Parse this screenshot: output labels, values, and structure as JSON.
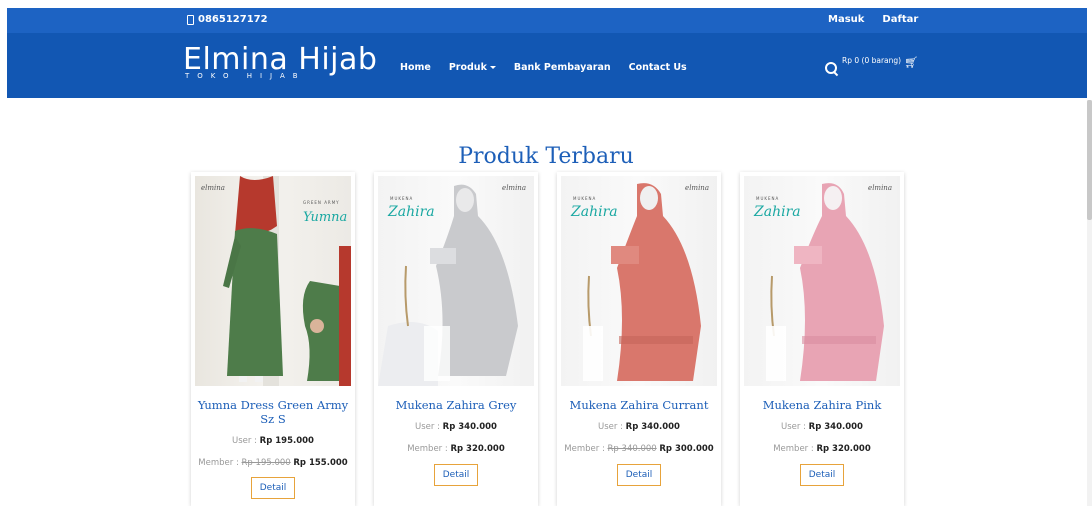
{
  "topbar": {
    "phone": "0865127172",
    "login": "Masuk",
    "register": "Daftar"
  },
  "brand": {
    "name": "Elmina Hijab",
    "tagline": "TOKO HIJAB"
  },
  "nav": {
    "home": "Home",
    "products": "Produk",
    "bank": "Bank Pembayaran",
    "contact": "Contact Us"
  },
  "cart": {
    "summary": "Rp 0 (0 barang)"
  },
  "section": {
    "title": "Produk Terbaru"
  },
  "products": [
    {
      "name": "Yumna Dress Green Army Sz S",
      "user_label": "User :",
      "user_price": "Rp 195.000",
      "member_label": "Member :",
      "member_old": "Rp 195.000",
      "member_price": "Rp 155.000",
      "detail": "Detail",
      "image_title": "Yumna",
      "image_subtitle": "GREEN ARMY",
      "image_brand": "elmina"
    },
    {
      "name": "Mukena Zahira Grey",
      "user_label": "User :",
      "user_price": "Rp 340.000",
      "member_label": "Member :",
      "member_old": "",
      "member_price": "Rp 320.000",
      "detail": "Detail",
      "image_title": "Zahira",
      "image_subtitle": "MUKENA",
      "image_brand": "elmina"
    },
    {
      "name": "Mukena Zahira Currant",
      "user_label": "User :",
      "user_price": "Rp 340.000",
      "member_label": "Member :",
      "member_old": "Rp 340.000",
      "member_price": "Rp 300.000",
      "detail": "Detail",
      "image_title": "Zahira",
      "image_subtitle": "MUKENA",
      "image_brand": "elmina"
    },
    {
      "name": "Mukena Zahira Pink",
      "user_label": "User :",
      "user_price": "Rp 340.000",
      "member_label": "Member :",
      "member_old": "",
      "member_price": "Rp 320.000",
      "detail": "Detail",
      "image_title": "Zahira",
      "image_subtitle": "MUKENA",
      "image_brand": "elmina"
    }
  ],
  "icons": {
    "phone": "phone-icon",
    "search": "search-icon",
    "cart": "cart-icon",
    "caret": "chevron-down-icon"
  },
  "colors": {
    "topbar": "#1d63c3",
    "navbar": "#1257b3",
    "accent": "#1d5fb8",
    "button_border": "#e7a33b",
    "green_dress": "#4e7c4a",
    "grey_mukena": "#c9cacd",
    "currant_mukena": "#d9776c",
    "pink_mukena": "#e8a4b4"
  }
}
